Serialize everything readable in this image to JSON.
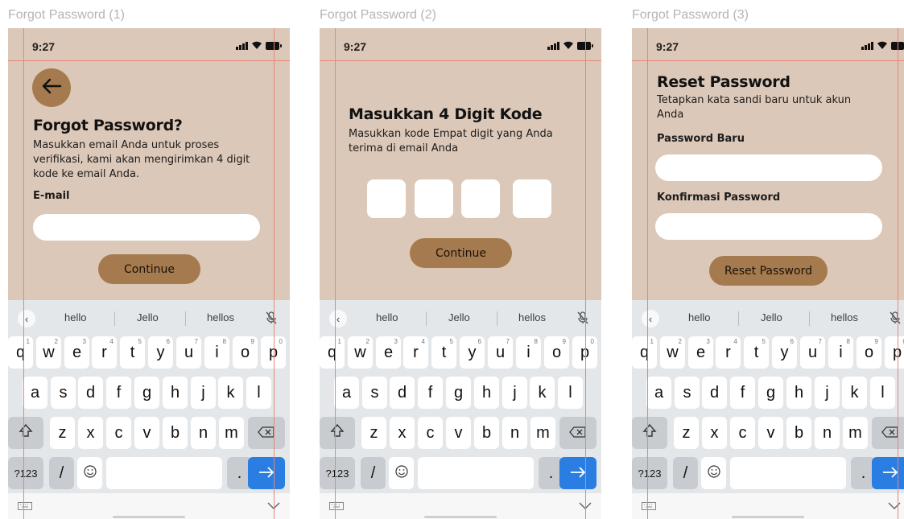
{
  "frames": [
    {
      "frame_label": "Forgot Password (1)",
      "status_time": "9:27",
      "title": "Forgot Password?",
      "subtitle": "Masukkan email Anda untuk proses verifikasi, kami akan mengirimkan 4 digit kode ke email Anda.",
      "email_label": "E-mail",
      "email_value": "",
      "button_label": "Continue"
    },
    {
      "frame_label": "Forgot Password (2)",
      "status_time": "9:27",
      "title": "Masukkan 4 Digit Kode",
      "subtitle": "Masukkan kode Empat digit yang Anda terima di email Anda",
      "code_digits": [
        "",
        "",
        "",
        ""
      ],
      "button_label": "Continue"
    },
    {
      "frame_label": "Forgot Password (3)",
      "status_time": "9:27",
      "title": "Reset Password",
      "subtitle": "Tetapkan kata sandi baru untuk akun Anda",
      "new_password_label": "Password Baru",
      "confirm_password_label": "Konfirmasi Password",
      "button_label": "Reset Password"
    }
  ],
  "keyboard": {
    "suggestions": [
      "hello",
      "Jello",
      "hellos"
    ],
    "row1": [
      "q",
      "w",
      "e",
      "r",
      "t",
      "y",
      "u",
      "i",
      "o",
      "p"
    ],
    "row1_hints": [
      "1",
      "2",
      "3",
      "4",
      "5",
      "6",
      "7",
      "8",
      "9",
      "0"
    ],
    "row2": [
      "a",
      "s",
      "d",
      "f",
      "g",
      "h",
      "j",
      "k",
      "l"
    ],
    "row3": [
      "z",
      "x",
      "c",
      "v",
      "b",
      "n",
      "m"
    ],
    "symbols_key": "?123",
    "slash_key": "/",
    "period_key": "."
  },
  "colors": {
    "app_background": "#dcc8b8",
    "accent_brown": "#a57a4e",
    "enter_key_blue": "#2a7de1",
    "guide_lines": "#e8867a"
  },
  "icons": [
    "arrow-left-icon",
    "signal-icon",
    "wifi-icon",
    "battery-icon",
    "mic-off-icon",
    "backspace-icon",
    "shift-icon",
    "emoji-icon",
    "arrow-right-icon",
    "keyboard-icon",
    "chevron-down-icon"
  ]
}
